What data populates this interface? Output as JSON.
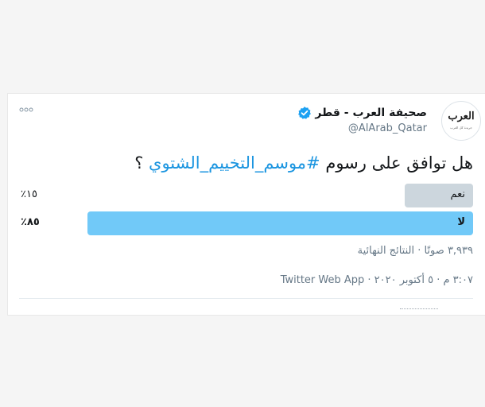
{
  "tweet": {
    "display_name": "صحيفة العرب - قطر",
    "handle": "@AlArab_Qatar",
    "logo_text": "العرب",
    "logo_tagline": "جريدة كل العرب",
    "question_prefix": "هل  توافق على رسوم ",
    "question_hashtag": "#موسم_التخييم_الشتوي",
    "question_suffix": " ؟",
    "icons": {
      "verified": "verified-badge-icon",
      "more": "more-options-icon"
    }
  },
  "poll": {
    "options": [
      {
        "label": "نعم",
        "percent_text": "٪١٥",
        "percent": 15,
        "winner": false,
        "color": "#ccd6dd"
      },
      {
        "label": "لا",
        "percent_text": "٪٨٥",
        "percent": 85,
        "winner": true,
        "color": "#71c9f8"
      }
    ],
    "summary": "٣,٩٣٩ صوتًا · النتائج النهائية"
  },
  "timestamp": "٣:٠٧ م · ٥ أكتوبر ٢٠٢٠ · Twitter Web App",
  "colors": {
    "link": "#1b95e0",
    "secondary": "#657786",
    "primary_text": "#14171a"
  }
}
